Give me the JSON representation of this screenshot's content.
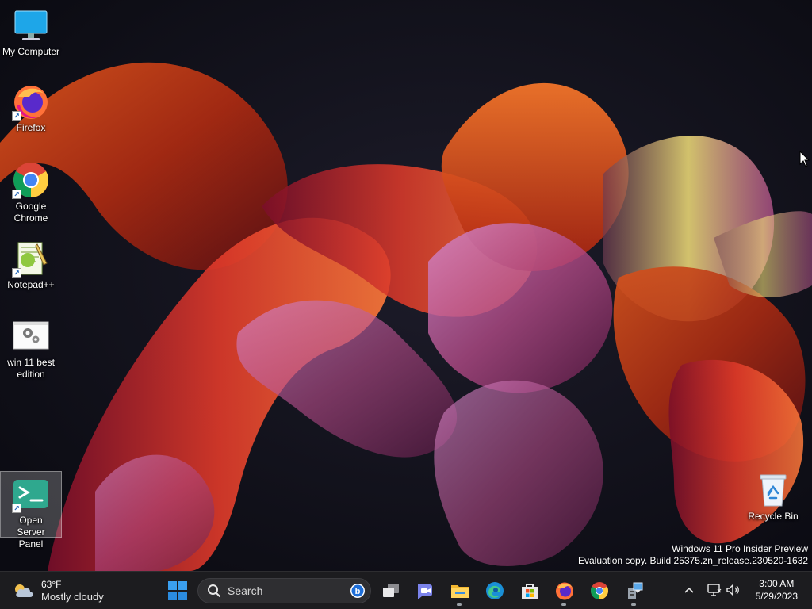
{
  "desktop": {
    "icons": [
      {
        "label": "My Computer",
        "icon": "monitor-icon"
      },
      {
        "label": "Firefox",
        "icon": "firefox-icon"
      },
      {
        "label": "Google Chrome",
        "icon": "chrome-icon"
      },
      {
        "label": "Notepad++",
        "icon": "notepadpp-icon"
      },
      {
        "label": "win 11 best edition",
        "icon": "settings-file-icon"
      },
      {
        "label": "Open Server Panel",
        "icon": "terminal-icon"
      },
      {
        "label": "Recycle Bin",
        "icon": "recycle-bin-icon"
      }
    ],
    "watermark": {
      "line1": "Windows 11 Pro Insider Preview",
      "line2": "Evaluation copy. Build 25375.zn_release.230520-1632"
    }
  },
  "taskbar": {
    "weather": {
      "temp": "63°F",
      "condition": "Mostly cloudy"
    },
    "search": {
      "placeholder": "Search"
    },
    "pinned": [
      "start-icon",
      "task-view-icon",
      "chat-icon",
      "file-explorer-icon",
      "edge-icon",
      "store-icon",
      "firefox-icon",
      "chrome-icon",
      "server-panel-icon"
    ],
    "clock": {
      "time": "3:00 AM",
      "date": "5/29/2023"
    }
  },
  "colors": {
    "taskbar": "#1c1c1f",
    "accent": "#0078d4"
  }
}
